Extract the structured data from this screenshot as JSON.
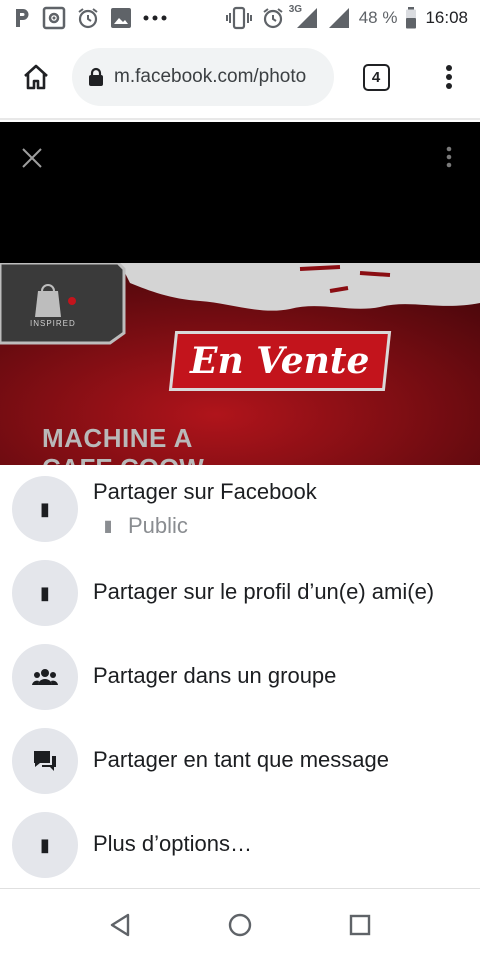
{
  "status_bar": {
    "battery_percent": "48 %",
    "time": "16:08",
    "network": "3G",
    "notification_icons": [
      "parking-icon",
      "photo-frame-icon",
      "alarm-icon",
      "image-icon",
      "more-notifications-icon"
    ],
    "system_icons": [
      "vibrate-icon",
      "alarm-icon",
      "signal-3g-icon",
      "signal-icon",
      "battery-icon"
    ]
  },
  "browser": {
    "url": "m.facebook.com/photo",
    "tab_count": "4"
  },
  "photo": {
    "badge_text": "En Vente",
    "headline_line1": "MACHINE A",
    "headline_line2": "CAFE COOW",
    "logo_caption": "INSPIRED"
  },
  "share_options": [
    {
      "icon": "facebook-share-icon",
      "label": "Partager sur Facebook",
      "audience_icon": "globe-icon",
      "audience": "Public"
    },
    {
      "icon": "friend-profile-icon",
      "label": "Partager sur le profil d’un(e) ami(e)"
    },
    {
      "icon": "group-icon",
      "label": "Partager dans un groupe"
    },
    {
      "icon": "message-icon",
      "label": "Partager en tant que message"
    },
    {
      "icon": "more-options-icon",
      "label": "Plus d’options…"
    }
  ],
  "colors": {
    "sheet_circle": "#e4e6eb",
    "text_primary": "#1c1e21",
    "text_secondary": "#8a8d91",
    "photo_red": "#c3141c"
  }
}
